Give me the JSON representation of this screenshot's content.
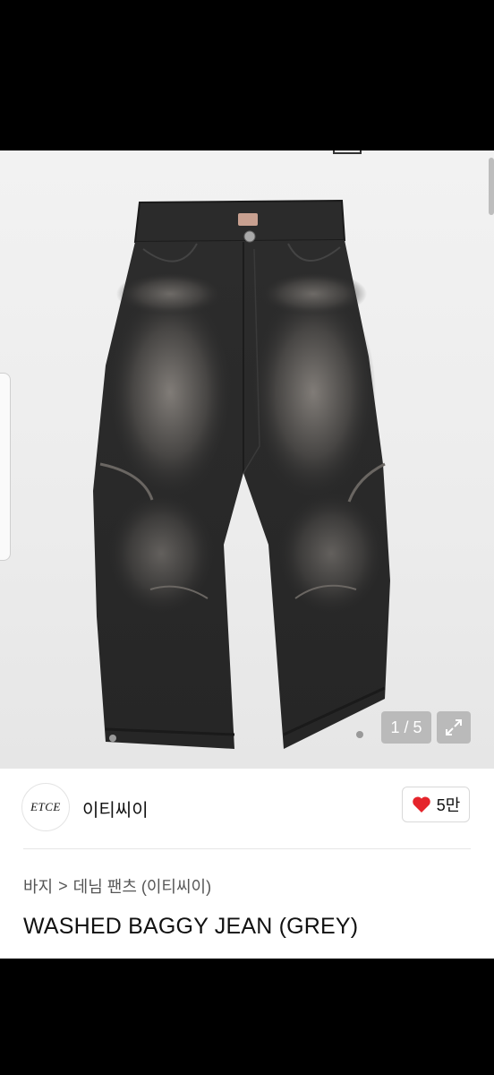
{
  "gallery": {
    "current": "1",
    "total": "5",
    "counter_text": "1 / 5"
  },
  "brand": {
    "logo_text": "ETCE",
    "name": "이티씨이"
  },
  "like": {
    "count": "5만",
    "color": "#e5242b"
  },
  "breadcrumb": {
    "category": "바지",
    "separator": ">",
    "subcategory": "데님 팬츠 (이티씨이)"
  },
  "product": {
    "title": "WASHED BAGGY JEAN (GREY)"
  },
  "icons": {
    "expand": "expand-icon",
    "heart": "heart-icon",
    "chevron": "chevron-right-icon"
  }
}
